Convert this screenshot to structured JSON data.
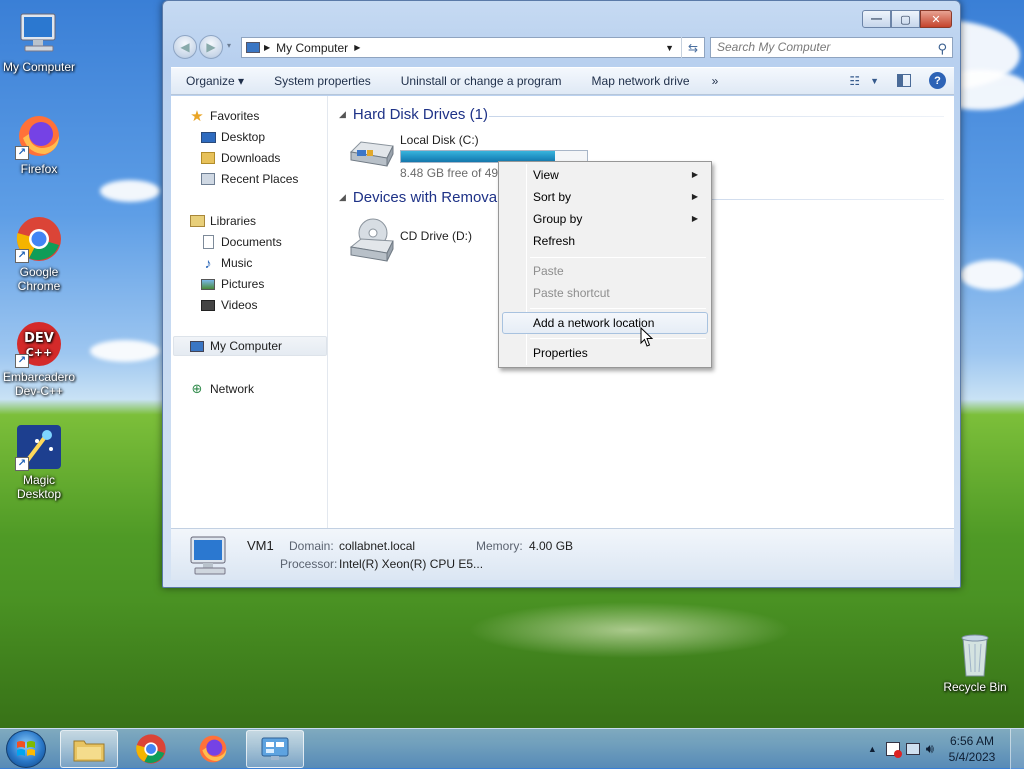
{
  "desktop": {
    "icons": [
      {
        "label": "My Computer"
      },
      {
        "label": "Firefox"
      },
      {
        "label": "Google Chrome"
      },
      {
        "label": "Embarcadero Dev-C++"
      },
      {
        "label": "Magic Desktop"
      },
      {
        "label": "Recycle Bin"
      }
    ]
  },
  "window": {
    "title_controls": {
      "minimize": "—",
      "maximize": "▢",
      "close": "✕"
    },
    "address": {
      "location": "My Computer"
    },
    "search": {
      "placeholder": "Search My Computer"
    },
    "command_bar": {
      "organize": "Organize ▾",
      "system_properties": "System properties",
      "uninstall": "Uninstall or change a program",
      "map_drive": "Map network drive",
      "more": "»"
    },
    "nav": {
      "favorites": "Favorites",
      "desktop": "Desktop",
      "downloads": "Downloads",
      "recent_places": "Recent Places",
      "libraries": "Libraries",
      "documents": "Documents",
      "music": "Music",
      "pictures": "Pictures",
      "videos": "Videos",
      "my_computer": "My Computer",
      "network": "Network"
    },
    "groups": {
      "hdd": "Hard Disk Drives (1)",
      "removable": "Devices with Removab"
    },
    "drives": {
      "c": {
        "name": "Local Disk (C:)",
        "free_text": "8.48 GB free of 49.8",
        "used_fraction": 0.83
      },
      "d": {
        "name": "CD Drive (D:)"
      }
    },
    "details": {
      "name": "VM1",
      "domain_label": "Domain:",
      "domain": "collabnet.local",
      "memory_label": "Memory:",
      "memory": "4.00 GB",
      "processor_label": "Processor:",
      "processor": "Intel(R) Xeon(R) CPU E5..."
    }
  },
  "context_menu": {
    "view": "View",
    "sort_by": "Sort by",
    "group_by": "Group by",
    "refresh": "Refresh",
    "paste": "Paste",
    "paste_shortcut": "Paste shortcut",
    "add_network_location": "Add a network location",
    "properties": "Properties"
  },
  "taskbar": {
    "clock_time": "6:56 AM",
    "clock_date": "5/4/2023"
  }
}
